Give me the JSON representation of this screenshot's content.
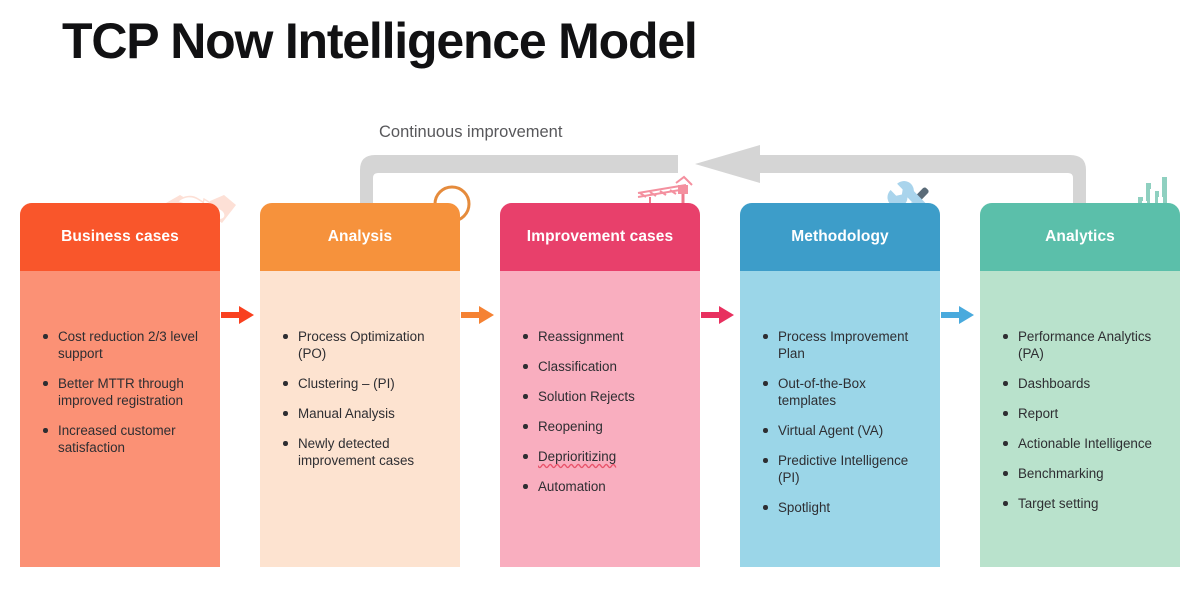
{
  "page": {
    "title": "TCP Now Intelligence Model",
    "background": "#ffffff",
    "title_color": "#111113"
  },
  "loop": {
    "label": "Continuous improvement",
    "label_color": "#58585b",
    "track_color": "#d5d5d5",
    "direction": "right-to-left",
    "from_column": "Analytics",
    "to_column": "Analysis"
  },
  "columns": [
    {
      "id": "business-cases",
      "title": "Business cases",
      "icon": "handshake-icon",
      "header_color": "#f9562b",
      "body_color": "#fb9175",
      "arrow_color": "#f9401f",
      "items": [
        {
          "text": "Cost reduction 2/3 level support",
          "misspelled": false
        },
        {
          "text": "Better MTTR through improved registration",
          "misspelled": false
        },
        {
          "text": "Increased customer satisfaction",
          "misspelled": false
        }
      ]
    },
    {
      "id": "analysis",
      "title": "Analysis",
      "icon": "magnifier-icon",
      "header_color": "#f6923c",
      "body_color": "#fde3d0",
      "arrow_color": "#f58233",
      "items": [
        {
          "text": "Process Optimization (PO)",
          "misspelled": false
        },
        {
          "text": "Clustering – (PI)",
          "misspelled": false
        },
        {
          "text": "Manual Analysis",
          "misspelled": false
        },
        {
          "text": "Newly detected improvement cases",
          "misspelled": false
        }
      ]
    },
    {
      "id": "improvement-cases",
      "title": "Improvement cases",
      "icon": "crane-icon",
      "header_color": "#e8406b",
      "body_color": "#f9aebf",
      "arrow_color": "#e8305f",
      "items": [
        {
          "text": "Reassignment",
          "misspelled": false
        },
        {
          "text": "Classification",
          "misspelled": false
        },
        {
          "text": "Solution Rejects",
          "misspelled": false
        },
        {
          "text": "Reopening",
          "misspelled": false
        },
        {
          "text": "Deprioritizing",
          "misspelled": true
        },
        {
          "text": "Automation",
          "misspelled": false
        }
      ]
    },
    {
      "id": "methodology",
      "title": "Methodology",
      "icon": "tools-icon",
      "header_color": "#3d9dc9",
      "body_color": "#9bd6e8",
      "arrow_color": "#49aadd",
      "items": [
        {
          "text": "Process Improvement Plan",
          "misspelled": false
        },
        {
          "text": "Out-of-the-Box templates",
          "misspelled": false
        },
        {
          "text": "Virtual Agent (VA)",
          "misspelled": false
        },
        {
          "text": "Predictive Intelligence (PI)",
          "misspelled": false
        },
        {
          "text": "Spotlight",
          "misspelled": false
        }
      ]
    },
    {
      "id": "analytics",
      "title": "Analytics",
      "icon": "gauge-chart-icon",
      "header_color": "#5bbfaa",
      "body_color": "#b9e2cc",
      "arrow_color": "#5bbfaa",
      "items": [
        {
          "text": "Performance Analytics (PA)",
          "misspelled": false
        },
        {
          "text": "Dashboards",
          "misspelled": false
        },
        {
          "text": "Report",
          "misspelled": false
        },
        {
          "text": "Actionable Intelligence",
          "misspelled": false
        },
        {
          "text": "Benchmarking",
          "misspelled": false
        },
        {
          "text": "Target setting",
          "misspelled": false
        }
      ]
    }
  ]
}
